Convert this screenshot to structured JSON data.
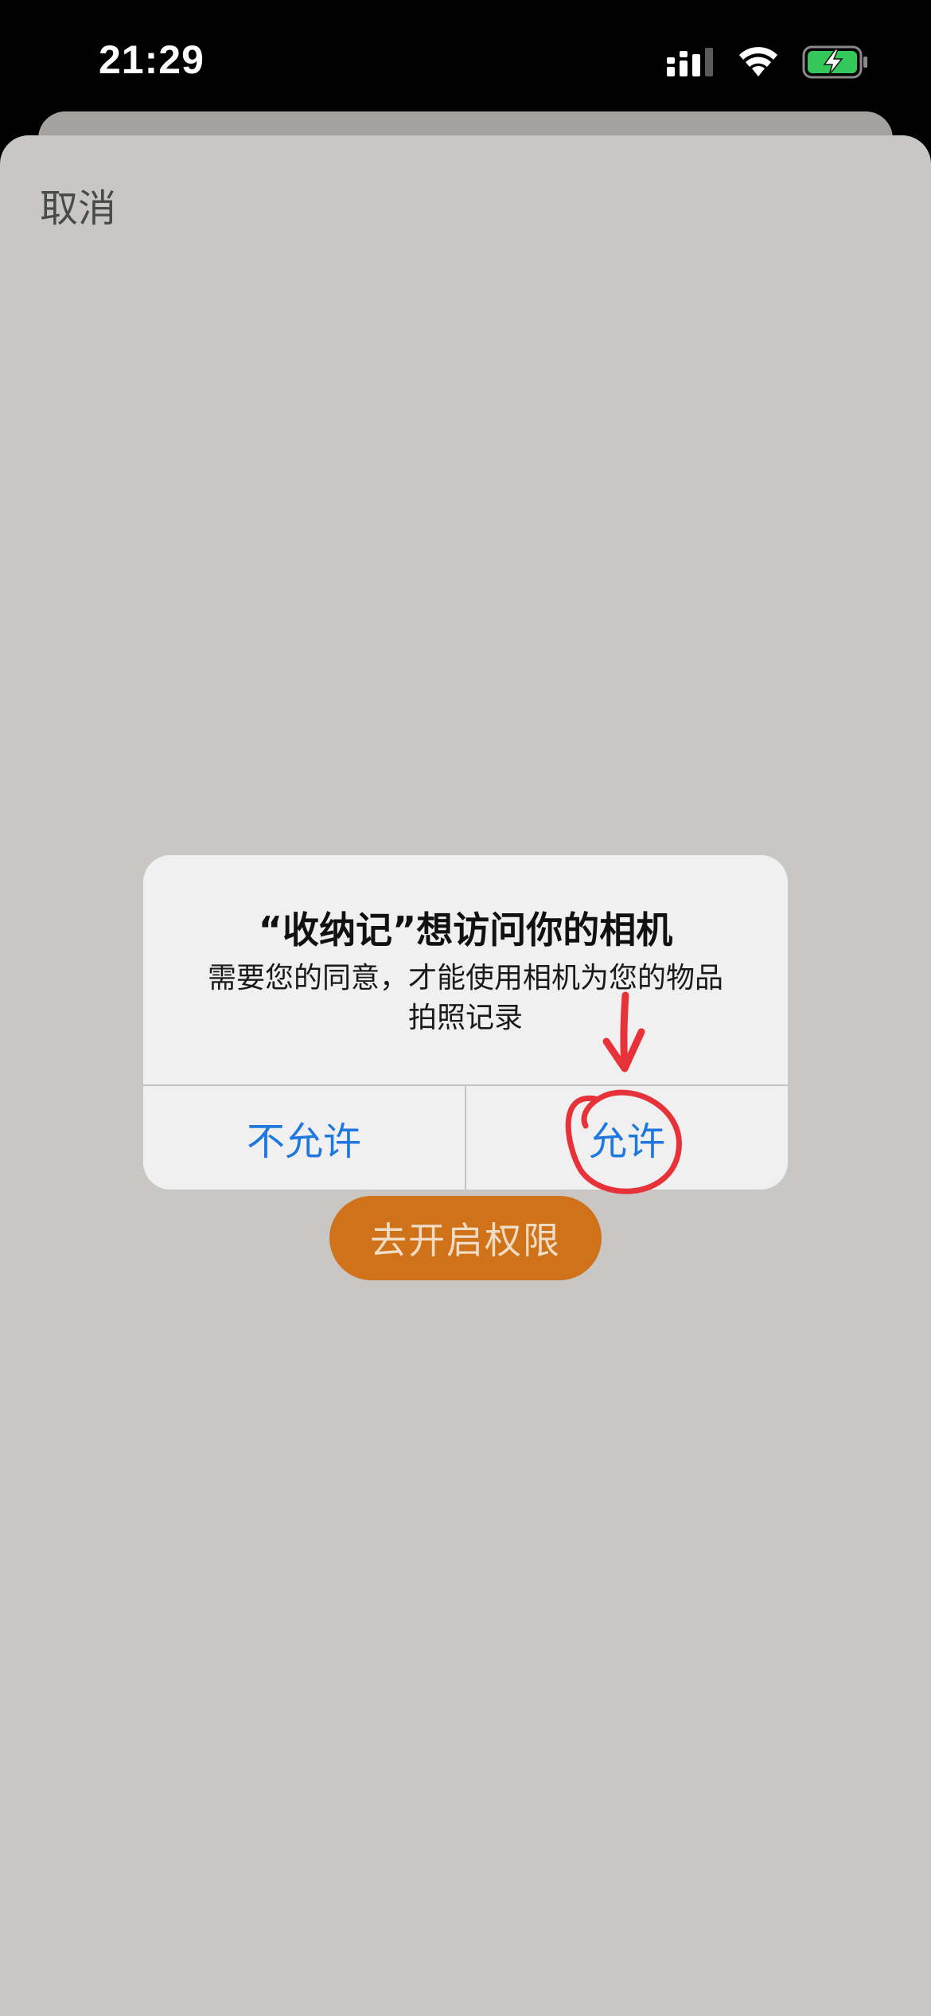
{
  "status_bar": {
    "time": "21:29",
    "icons": [
      "signal-icon",
      "wifi-icon",
      "battery-charging-icon"
    ],
    "battery_color": "#34c759"
  },
  "sheet": {
    "cancel_label": "取消",
    "open_permission_label": "去开启权限",
    "accent_color": "#cf7219"
  },
  "alert": {
    "title": "“收纳记”想访问你的相机",
    "message": "需要您的同意，才能使用相机为您的物品拍照记录",
    "deny_label": "不允许",
    "allow_label": "允许",
    "button_color": "#1f78e0"
  },
  "annotation": {
    "type": "red-arrow-and-circle",
    "target": "allow-button",
    "color": "#e8323a"
  }
}
